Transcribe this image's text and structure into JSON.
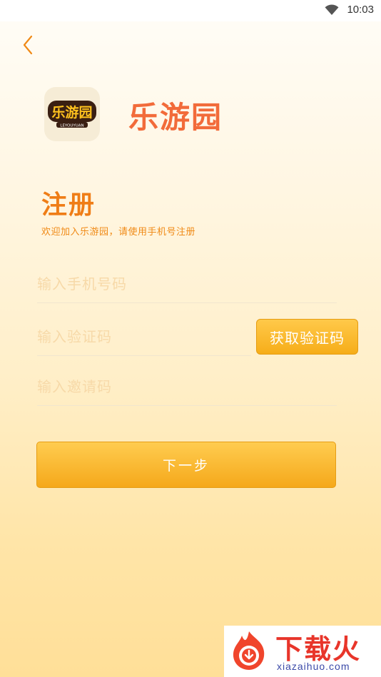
{
  "status_bar": {
    "time": "10:03",
    "wifi_icon": "wifi-icon"
  },
  "header": {
    "back_icon": "chevron-left-icon"
  },
  "app": {
    "name": "乐游园",
    "logo_text": "乐游园",
    "logo_subtext": "LEYOUYUAN"
  },
  "register": {
    "title": "注册",
    "subtitle": "欢迎加入乐游园，请使用手机号注册"
  },
  "form": {
    "phone": {
      "value": "",
      "placeholder": "输入手机号码"
    },
    "code": {
      "value": "",
      "placeholder": "输入验证码"
    },
    "invite": {
      "value": "",
      "placeholder": "输入邀请码"
    },
    "get_code_label": "获取验证码",
    "next_label": "下一步"
  },
  "watermark": {
    "title": "下载火",
    "url": "xiazaihuo.com"
  },
  "colors": {
    "accent": "#f5a81a",
    "title": "#ef7d16",
    "app_name": "#f26b3a"
  }
}
